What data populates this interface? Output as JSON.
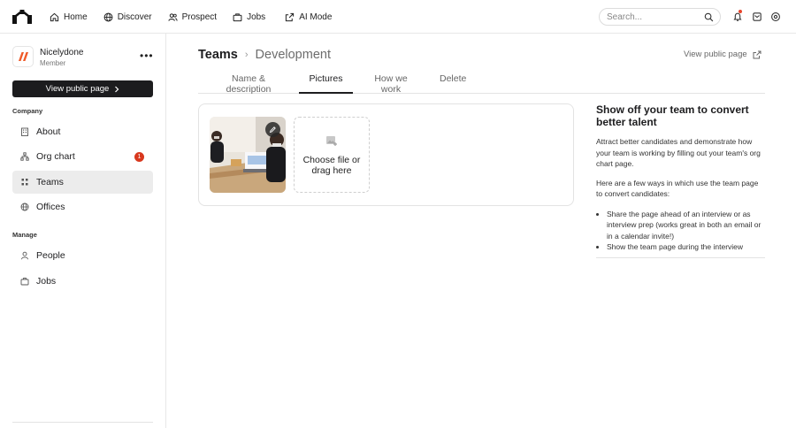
{
  "nav": {
    "items": [
      {
        "label": "Home",
        "icon": "home-icon"
      },
      {
        "label": "Discover",
        "icon": "globe-icon"
      },
      {
        "label": "Prospect",
        "icon": "users-icon"
      },
      {
        "label": "Jobs",
        "icon": "briefcase-icon"
      },
      {
        "label": "AI Mode",
        "icon": "export-icon"
      }
    ],
    "search_placeholder": "Search..."
  },
  "org": {
    "name": "Nicelydone",
    "role": "Member",
    "more": "•••",
    "view_public_label": "View public page"
  },
  "sidebar": {
    "company_label": "Company",
    "company_items": [
      {
        "label": "About",
        "icon": "building-icon"
      },
      {
        "label": "Org chart",
        "icon": "org-chart-icon",
        "badge": "1"
      },
      {
        "label": "Teams",
        "icon": "teams-icon",
        "active": true
      },
      {
        "label": "Offices",
        "icon": "globe-icon"
      }
    ],
    "manage_label": "Manage",
    "manage_items": [
      {
        "label": "People",
        "icon": "person-icon"
      },
      {
        "label": "Jobs",
        "icon": "briefcase-icon"
      }
    ]
  },
  "header": {
    "root": "Teams",
    "separator": "›",
    "current": "Development",
    "view_public_label": "View public page"
  },
  "tabs": [
    {
      "label": "Name & description"
    },
    {
      "label": "Pictures",
      "active": true
    },
    {
      "label": "How we work"
    },
    {
      "label": "Delete"
    }
  ],
  "pictures": {
    "upload_label": "Choose file or drag here"
  },
  "help": {
    "title": "Show off your team to convert better talent",
    "paragraph1": "Attract better candidates and demonstrate how your team is working by filling out your team's org chart page.",
    "paragraph2": "Here are a few ways in which use the team page to convert candidates:",
    "bullets": [
      "Share the page ahead of an interview or as interview prep (works great in both an email or in a calendar invite!)",
      "Show the team page during the interview"
    ]
  },
  "colors": {
    "accent_dark": "#1c1c1e",
    "badge_red": "#d8381e",
    "logo_orange": "#f05a28"
  }
}
